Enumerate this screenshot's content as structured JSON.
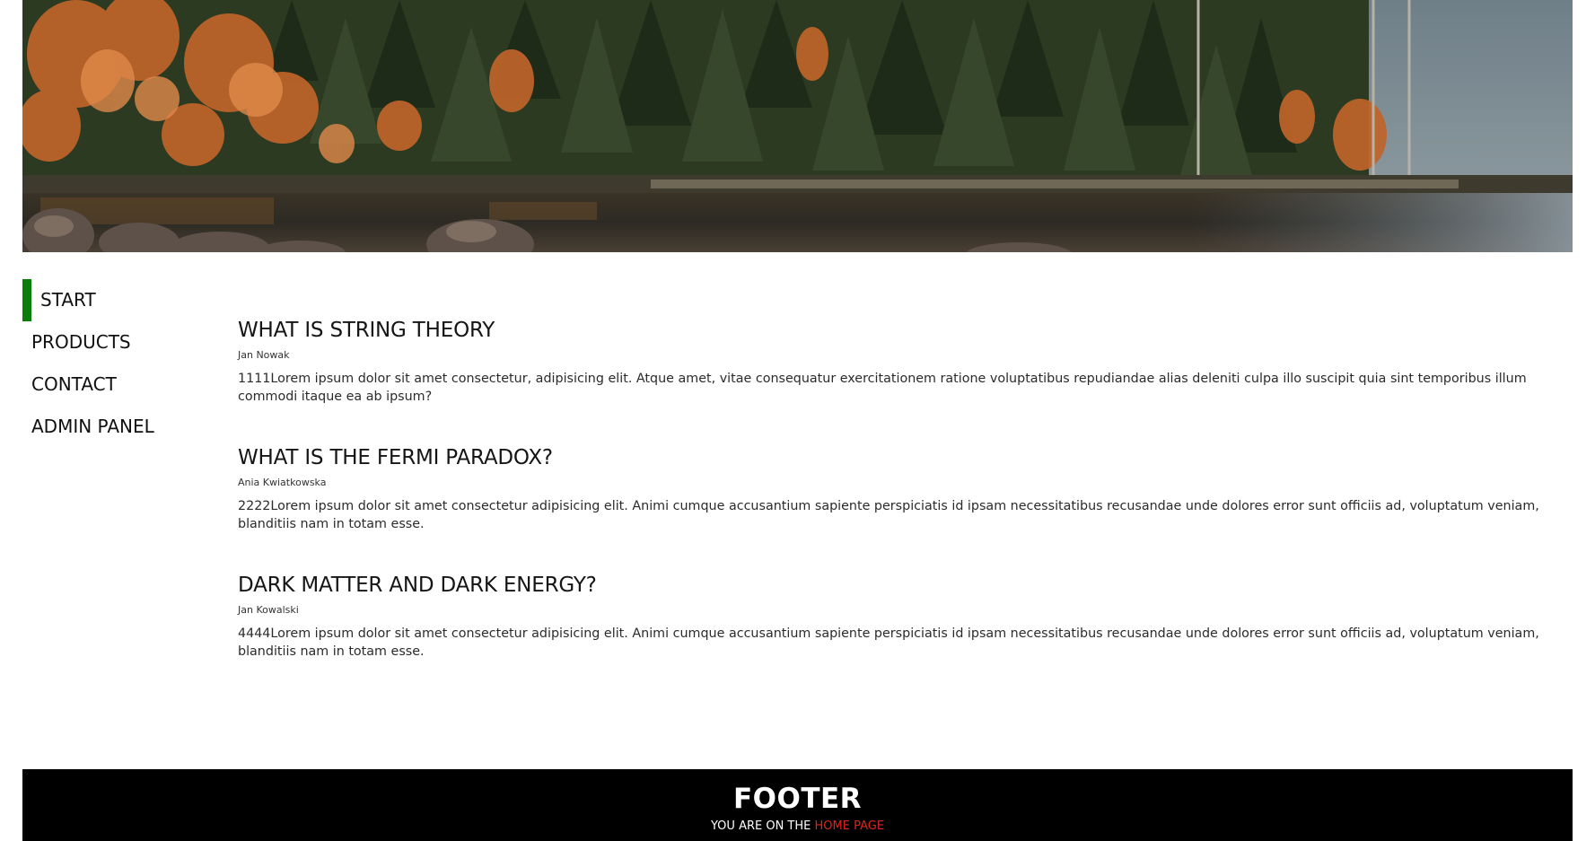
{
  "nav": {
    "items": [
      {
        "label": "START",
        "active": true
      },
      {
        "label": "PRODUCTS",
        "active": false
      },
      {
        "label": "CONTACT",
        "active": false
      },
      {
        "label": "ADMIN PANEL",
        "active": false
      }
    ]
  },
  "articles": [
    {
      "title": "WHAT IS STRING THEORY",
      "author": "Jan Nowak",
      "body": "1111Lorem ipsum dolor sit amet consectetur, adipisicing elit. Atque amet, vitae consequatur exercitationem ratione voluptatibus repudiandae alias deleniti culpa illo suscipit quia sint temporibus illum commodi itaque ea ab ipsum?"
    },
    {
      "title": "WHAT IS THE FERMI PARADOX?",
      "author": "Ania Kwiatkowska",
      "body": "2222Lorem ipsum dolor sit amet consectetur adipisicing elit. Animi cumque accusantium sapiente perspiciatis id ipsam necessitatibus recusandae unde dolores error sunt officiis ad, voluptatum veniam, blanditiis nam in totam esse."
    },
    {
      "title": "DARK MATTER AND DARK ENERGY?",
      "author": "Jan Kowalski",
      "body": "4444Lorem ipsum dolor sit amet consectetur adipisicing elit. Animi cumque accusantium sapiente perspiciatis id ipsam necessitatibus recusandae unde dolores error sunt officiis ad, voluptatum veniam, blanditiis nam in totam esse."
    }
  ],
  "footer": {
    "title": "FOOTER",
    "prefix": "YOU ARE ON THE ",
    "page_name": "HOME PAGE"
  },
  "colors": {
    "nav_active_marker": "#0a7d0a",
    "footer_bg": "#000000",
    "footer_highlight": "#e0241c"
  }
}
